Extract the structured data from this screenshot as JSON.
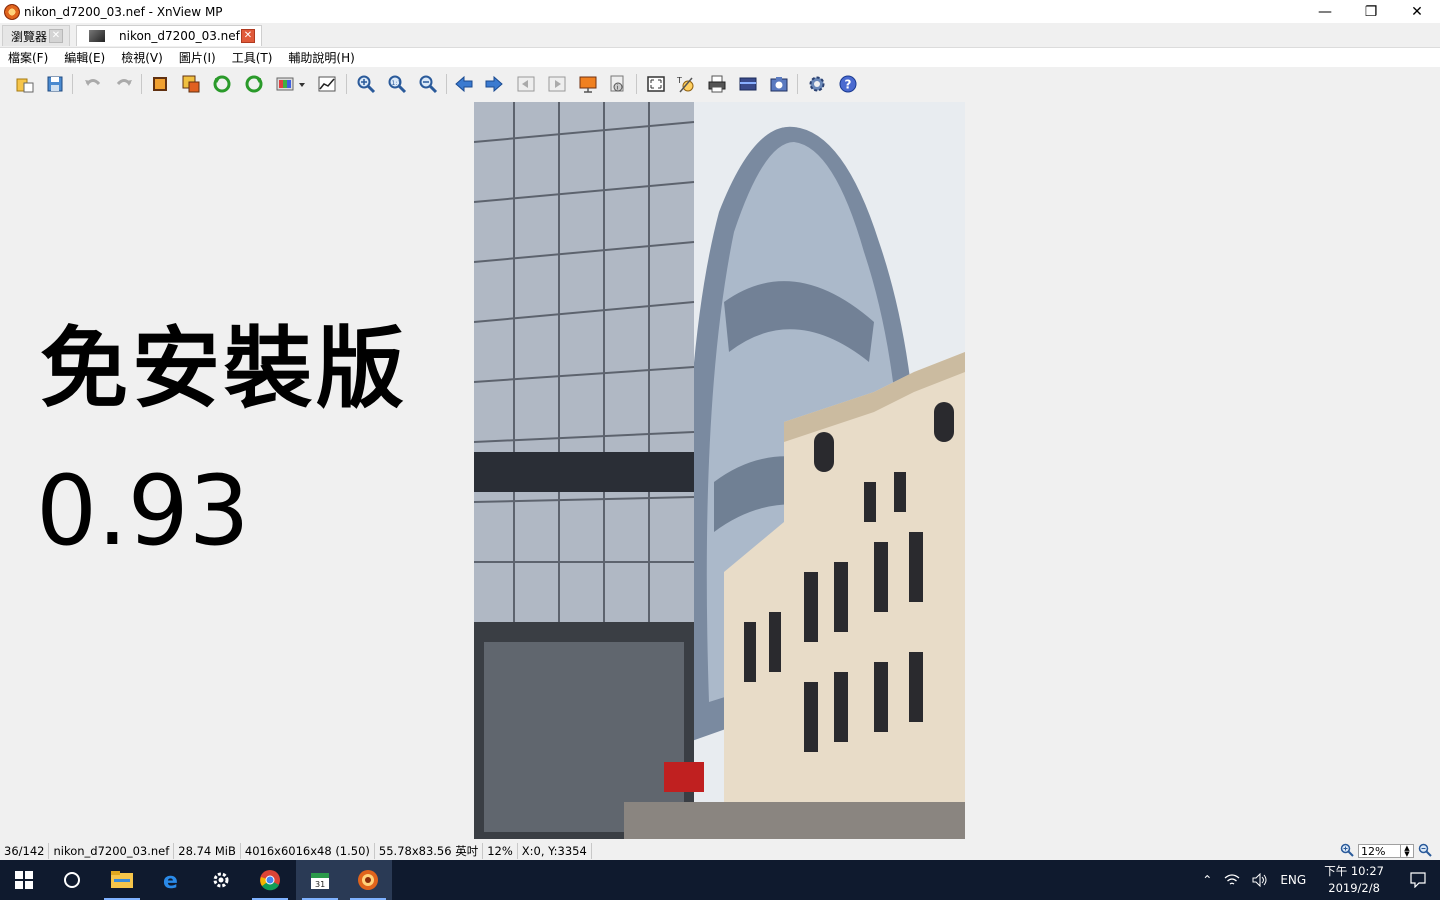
{
  "window": {
    "title": "nikon_d7200_03.nef - XnView MP"
  },
  "tabs": [
    {
      "label": "瀏覽器"
    },
    {
      "label": "nikon_d7200_03.nef"
    }
  ],
  "menu": [
    "檔案(F)",
    "編輯(E)",
    "檢視(V)",
    "圖片(I)",
    "工具(T)",
    "輔助說明(H)"
  ],
  "overlay": {
    "title": "免安裝版",
    "version": "0.93"
  },
  "status": {
    "index": "36/142",
    "filename": "nikon_d7200_03.nef",
    "filesize": "28.74 MiB",
    "dimensions": "4016x6016x48 (1.50)",
    "print_size": "55.78x83.56 英吋",
    "zoom": "12%",
    "coords": "X:0, Y:3354"
  },
  "zoom_field": {
    "value": "12%"
  },
  "taskbar": {
    "language": "ENG",
    "time": "下午 10:27",
    "date": "2019/2/8"
  },
  "colors": {
    "taskbar": "#0f1a2e",
    "accent": "#e05a3a"
  }
}
